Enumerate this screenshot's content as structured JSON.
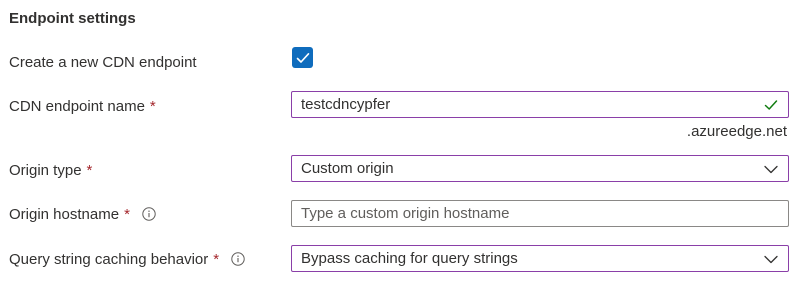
{
  "section": {
    "title": "Endpoint settings"
  },
  "create_endpoint": {
    "label": "Create a new CDN endpoint",
    "checked": true
  },
  "endpoint_name": {
    "label": "CDN endpoint name",
    "required_mark": "*",
    "value": "testcdncypfer",
    "suffix": ".azureedge.net",
    "status_icon": "checkmark-icon"
  },
  "origin_type": {
    "label": "Origin type",
    "required_mark": "*",
    "selected": "Custom origin"
  },
  "origin_hostname": {
    "label": "Origin hostname",
    "required_mark": "*",
    "placeholder": "Type a custom origin hostname",
    "value": ""
  },
  "query_string": {
    "label": "Query string caching behavior",
    "required_mark": "*",
    "selected": "Bypass caching for query strings"
  },
  "colors": {
    "accent": "#0f6cbd",
    "focus_border": "#8a3fa8",
    "required": "#a4262c",
    "success": "#107c10"
  }
}
